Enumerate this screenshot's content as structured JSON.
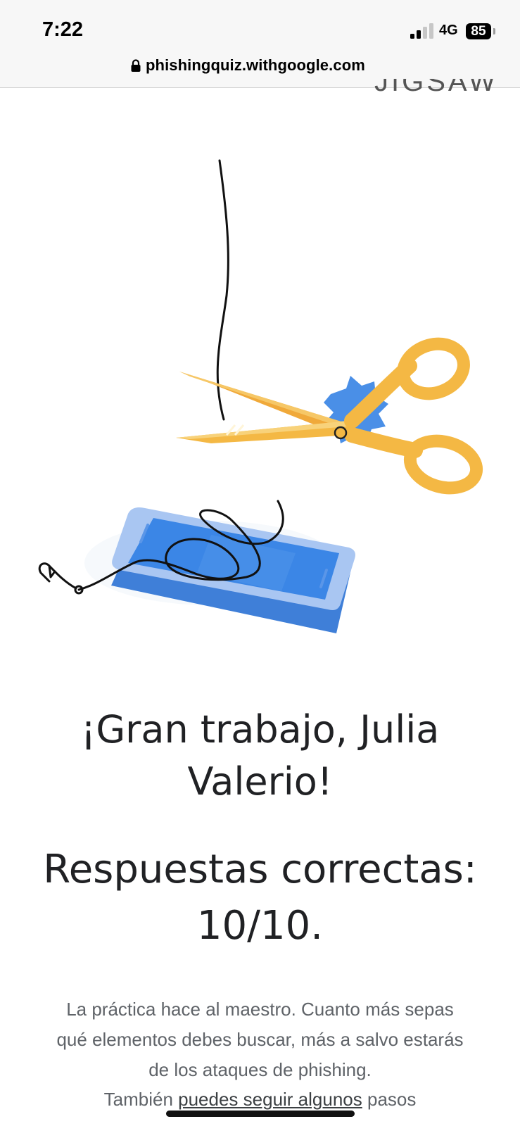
{
  "status_bar": {
    "time": "7:22",
    "network": "4G",
    "battery": "85"
  },
  "browser": {
    "url": "phishingquiz.withgoogle.com",
    "lock_icon": "lock-icon"
  },
  "header": {
    "logo_text": "JIGSAW"
  },
  "illustration": {
    "icons": [
      "fishing-line-icon",
      "scissors-icon",
      "phone-icon",
      "fish-hook-icon"
    ],
    "colors": {
      "scissors": "#f4b844",
      "scissors_dark": "#e9a52b",
      "burst": "#4a8fe7",
      "phone_screen": "#3b86e6",
      "phone_body": "#a9c6f2",
      "phone_shadow": "#3f7fd8"
    }
  },
  "result": {
    "title": "¡Gran trabajo, Julia Valerio!",
    "score": "Respuestas correctas: 10/10.",
    "message": "La práctica hace al maestro. Cuanto más sepas qué elementos debes buscar, más a salvo estarás de los ataques de phishing.",
    "next_prefix": "También ",
    "next_link": "puedes seguir algunos",
    "next_suffix": " pasos"
  }
}
